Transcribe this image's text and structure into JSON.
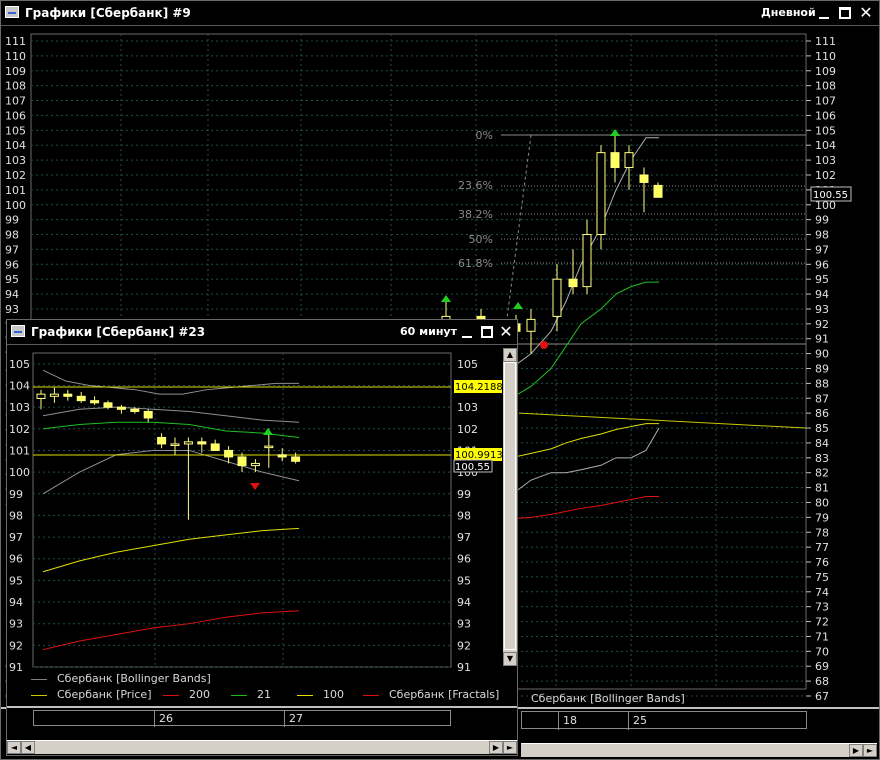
{
  "main_window": {
    "title": "Графики [Сбербанк] #9",
    "timeframe": "Дневной",
    "price_axis": [
      "111",
      "110",
      "109",
      "108",
      "107",
      "106",
      "105",
      "104",
      "103",
      "102",
      "101",
      "100",
      "99",
      "98",
      "97",
      "96",
      "95",
      "94",
      "93",
      "92",
      "91",
      "90",
      "89",
      "88",
      "87",
      "86",
      "85",
      "84",
      "83",
      "82",
      "81",
      "80",
      "79",
      "78",
      "77",
      "76",
      "75",
      "74",
      "73",
      "72",
      "71",
      "70",
      "69",
      "68",
      "67"
    ],
    "current_price_tag": "100.55",
    "fib_levels": [
      "0%",
      "23.6%",
      "38.2%",
      "50%",
      "61.8%"
    ],
    "legend_visible": "Сбербанк [Bollinger Bands]",
    "date_labels": [
      "18",
      "25"
    ]
  },
  "sub_window": {
    "title": "Графики [Сбербанк] #23",
    "timeframe": "60 минут",
    "price_axis": [
      "105",
      "104",
      "103",
      "102",
      "101",
      "100",
      "99",
      "98",
      "97",
      "96",
      "95",
      "94",
      "93",
      "92",
      "91"
    ],
    "price_tags": [
      "104.21889",
      "100.99133",
      "100.55"
    ],
    "legend": [
      {
        "label": "Сбербанк [Bollinger Bands]",
        "color": "#808080"
      },
      {
        "label": "Сбербанк [Price]",
        "color": "#c8c800"
      },
      {
        "label": "200",
        "color": "#e01010"
      },
      {
        "label": "21",
        "color": "#10c010"
      },
      {
        "label": "100",
        "color": "#e0e000"
      },
      {
        "label": "Сбербанк [Fractals]",
        "color": "#e01010"
      }
    ],
    "date_labels": [
      "26",
      "27"
    ]
  },
  "chart_data": [
    {
      "type": "candlestick",
      "title": "Графики [Сбербанк] #9",
      "ylim": [
        67,
        111
      ],
      "x": [
        1,
        2,
        3,
        4,
        5,
        6,
        7,
        8,
        9,
        10,
        11,
        12,
        13,
        14,
        15,
        16,
        17,
        18
      ],
      "open": [
        92.0,
        92.5,
        92.0,
        91.5,
        92.5,
        95.0,
        94.5,
        98.0,
        103.5,
        102.5,
        102.0,
        101.3
      ],
      "high": [
        93.5,
        93.0,
        92.6,
        93.0,
        96.0,
        97.0,
        99.0,
        104.0,
        105.0,
        104.0,
        102.5,
        101.5
      ],
      "low": [
        91.0,
        91.2,
        91.0,
        90.0,
        91.5,
        94.0,
        94.0,
        97.0,
        101.5,
        101.0,
        99.5,
        100.5
      ],
      "close": [
        92.5,
        92.0,
        91.5,
        92.3,
        95.0,
        94.5,
        98.0,
        103.5,
        102.5,
        103.5,
        101.5,
        100.5
      ],
      "series": [
        {
          "name": "Сбербанк [Bollinger Bands]",
          "values": [
            87.0,
            88.0,
            89.0,
            90.0,
            91.5,
            93.5,
            96.0,
            98.5,
            101.0,
            103.0,
            104.5,
            104.5
          ]
        },
        {
          "name": "21",
          "values": [
            85.0,
            86.0,
            87.0,
            87.8,
            89.0,
            90.5,
            92.0,
            93.0,
            94.0,
            94.5,
            94.8,
            94.8
          ]
        },
        {
          "name": "100",
          "values": [
            82.0,
            82.5,
            83.0,
            83.3,
            83.6,
            84.0,
            84.3,
            84.6,
            84.9,
            85.1,
            85.3,
            85.3
          ]
        },
        {
          "name": "200",
          "values": [
            78.5,
            78.7,
            78.9,
            79.0,
            79.2,
            79.4,
            79.6,
            79.8,
            80.0,
            80.2,
            80.4,
            80.4
          ]
        }
      ]
    },
    {
      "type": "candlestick",
      "title": "Графики [Сбербанк] #23",
      "ylim": [
        91,
        105.5
      ],
      "x": [
        1,
        2,
        3,
        4,
        5,
        6,
        7,
        8,
        9,
        10,
        11,
        12,
        13,
        14,
        15,
        16,
        17,
        18,
        19,
        20
      ],
      "open": [
        103.4,
        103.5,
        103.6,
        103.5,
        103.3,
        103.2,
        103.0,
        102.9,
        102.8,
        101.6,
        101.3,
        101.3,
        101.4,
        101.3,
        101.0,
        100.7,
        100.3,
        101.2,
        100.8,
        100.7
      ],
      "high": [
        103.8,
        103.9,
        103.8,
        103.7,
        103.5,
        103.3,
        103.1,
        103.0,
        102.9,
        101.8,
        101.6,
        101.6,
        101.6,
        101.5,
        101.2,
        100.9,
        100.6,
        102.0,
        101.1,
        100.9
      ],
      "low": [
        102.9,
        103.2,
        103.3,
        103.2,
        103.1,
        102.9,
        102.7,
        102.7,
        102.3,
        101.1,
        100.8,
        97.8,
        100.9,
        101.0,
        100.4,
        100.0,
        100.0,
        100.2,
        100.5,
        100.4
      ],
      "close": [
        103.6,
        103.6,
        103.5,
        103.3,
        103.2,
        103.0,
        102.9,
        102.8,
        102.5,
        101.3,
        101.3,
        101.4,
        101.3,
        101.0,
        100.7,
        100.3,
        100.4,
        101.2,
        100.7,
        100.5
      ],
      "series": [
        {
          "name": "Сбербанк [Bollinger Bands]",
          "values": [
            104.7,
            104.2,
            104.0,
            103.9,
            103.8,
            103.6,
            103.6,
            103.8,
            103.9,
            104.0,
            104.1,
            104.1
          ]
        },
        {
          "name": "21",
          "values": [
            102.0,
            102.2,
            102.3,
            102.3,
            102.2,
            101.9,
            101.8,
            101.6
          ]
        },
        {
          "name": "100",
          "values": [
            95.4,
            95.9,
            96.3,
            96.6,
            96.9,
            97.1,
            97.3,
            97.4
          ]
        },
        {
          "name": "200",
          "values": [
            91.8,
            92.2,
            92.5,
            92.8,
            93.0,
            93.3,
            93.5,
            93.6
          ]
        }
      ]
    }
  ]
}
